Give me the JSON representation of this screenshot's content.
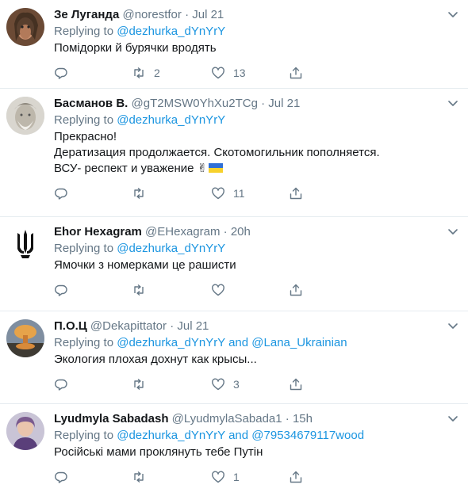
{
  "tweets": [
    {
      "name": "Зе Луганда",
      "handle": "@norestfor",
      "time": "Jul 21",
      "replying_label": "Replying to",
      "replying_to": [
        "@dezhurka_dYnYrY"
      ],
      "text_lines": [
        "Помідорки й бурячки вродять"
      ],
      "counts": {
        "reply": "",
        "retweet": "2",
        "like": "13"
      }
    },
    {
      "name": "Басманов В.",
      "handle": "@gT2MSW0YhXu2TCg",
      "time": "Jul 21",
      "replying_label": "Replying to",
      "replying_to": [
        "@dezhurka_dYnYrY"
      ],
      "text_lines": [
        "Прекрасно!",
        "Дератизация продолжается. Скотомогильник пополняется.",
        "ВСУ- респект и уважение ✌"
      ],
      "counts": {
        "reply": "",
        "retweet": "",
        "like": "11"
      }
    },
    {
      "name": "Ehor Hexagram",
      "handle": "@EHexagram",
      "time": "20h",
      "replying_label": "Replying to",
      "replying_to": [
        "@dezhurka_dYnYrY"
      ],
      "text_lines": [
        "Ямочки з номерками це рашисти"
      ],
      "counts": {
        "reply": "",
        "retweet": "",
        "like": ""
      }
    },
    {
      "name": "П.О.Ц",
      "handle": "@Dekapittator",
      "time": "Jul 21",
      "replying_label": "Replying to",
      "replying_to": [
        "@dezhurka_dYnYrY",
        "@Lana_Ukrainian"
      ],
      "conjunction": "and",
      "text_lines": [
        "Экология плохая дохнут как крысы..."
      ],
      "counts": {
        "reply": "",
        "retweet": "",
        "like": "3"
      }
    },
    {
      "name": "Lyudmyla Sabadash",
      "handle": "@LyudmylaSabada1",
      "time": "15h",
      "replying_label": "Replying to",
      "replying_to": [
        "@dezhurka_dYnYrY",
        "@79534679117wood"
      ],
      "conjunction": "and",
      "text_lines": [
        "Російські мами проклянуть тебе Путін"
      ],
      "counts": {
        "reply": "",
        "retweet": "",
        "like": "1"
      }
    }
  ],
  "icons": {
    "reply": "reply-icon",
    "retweet": "retweet-icon",
    "like": "heart-icon",
    "share": "share-icon",
    "more": "chevron-down-icon",
    "flag": "ukraine-flag-icon"
  },
  "colors": {
    "link": "#1b95e0",
    "muted": "#657786",
    "divider": "#e6ecf0",
    "text": "#14171a"
  }
}
